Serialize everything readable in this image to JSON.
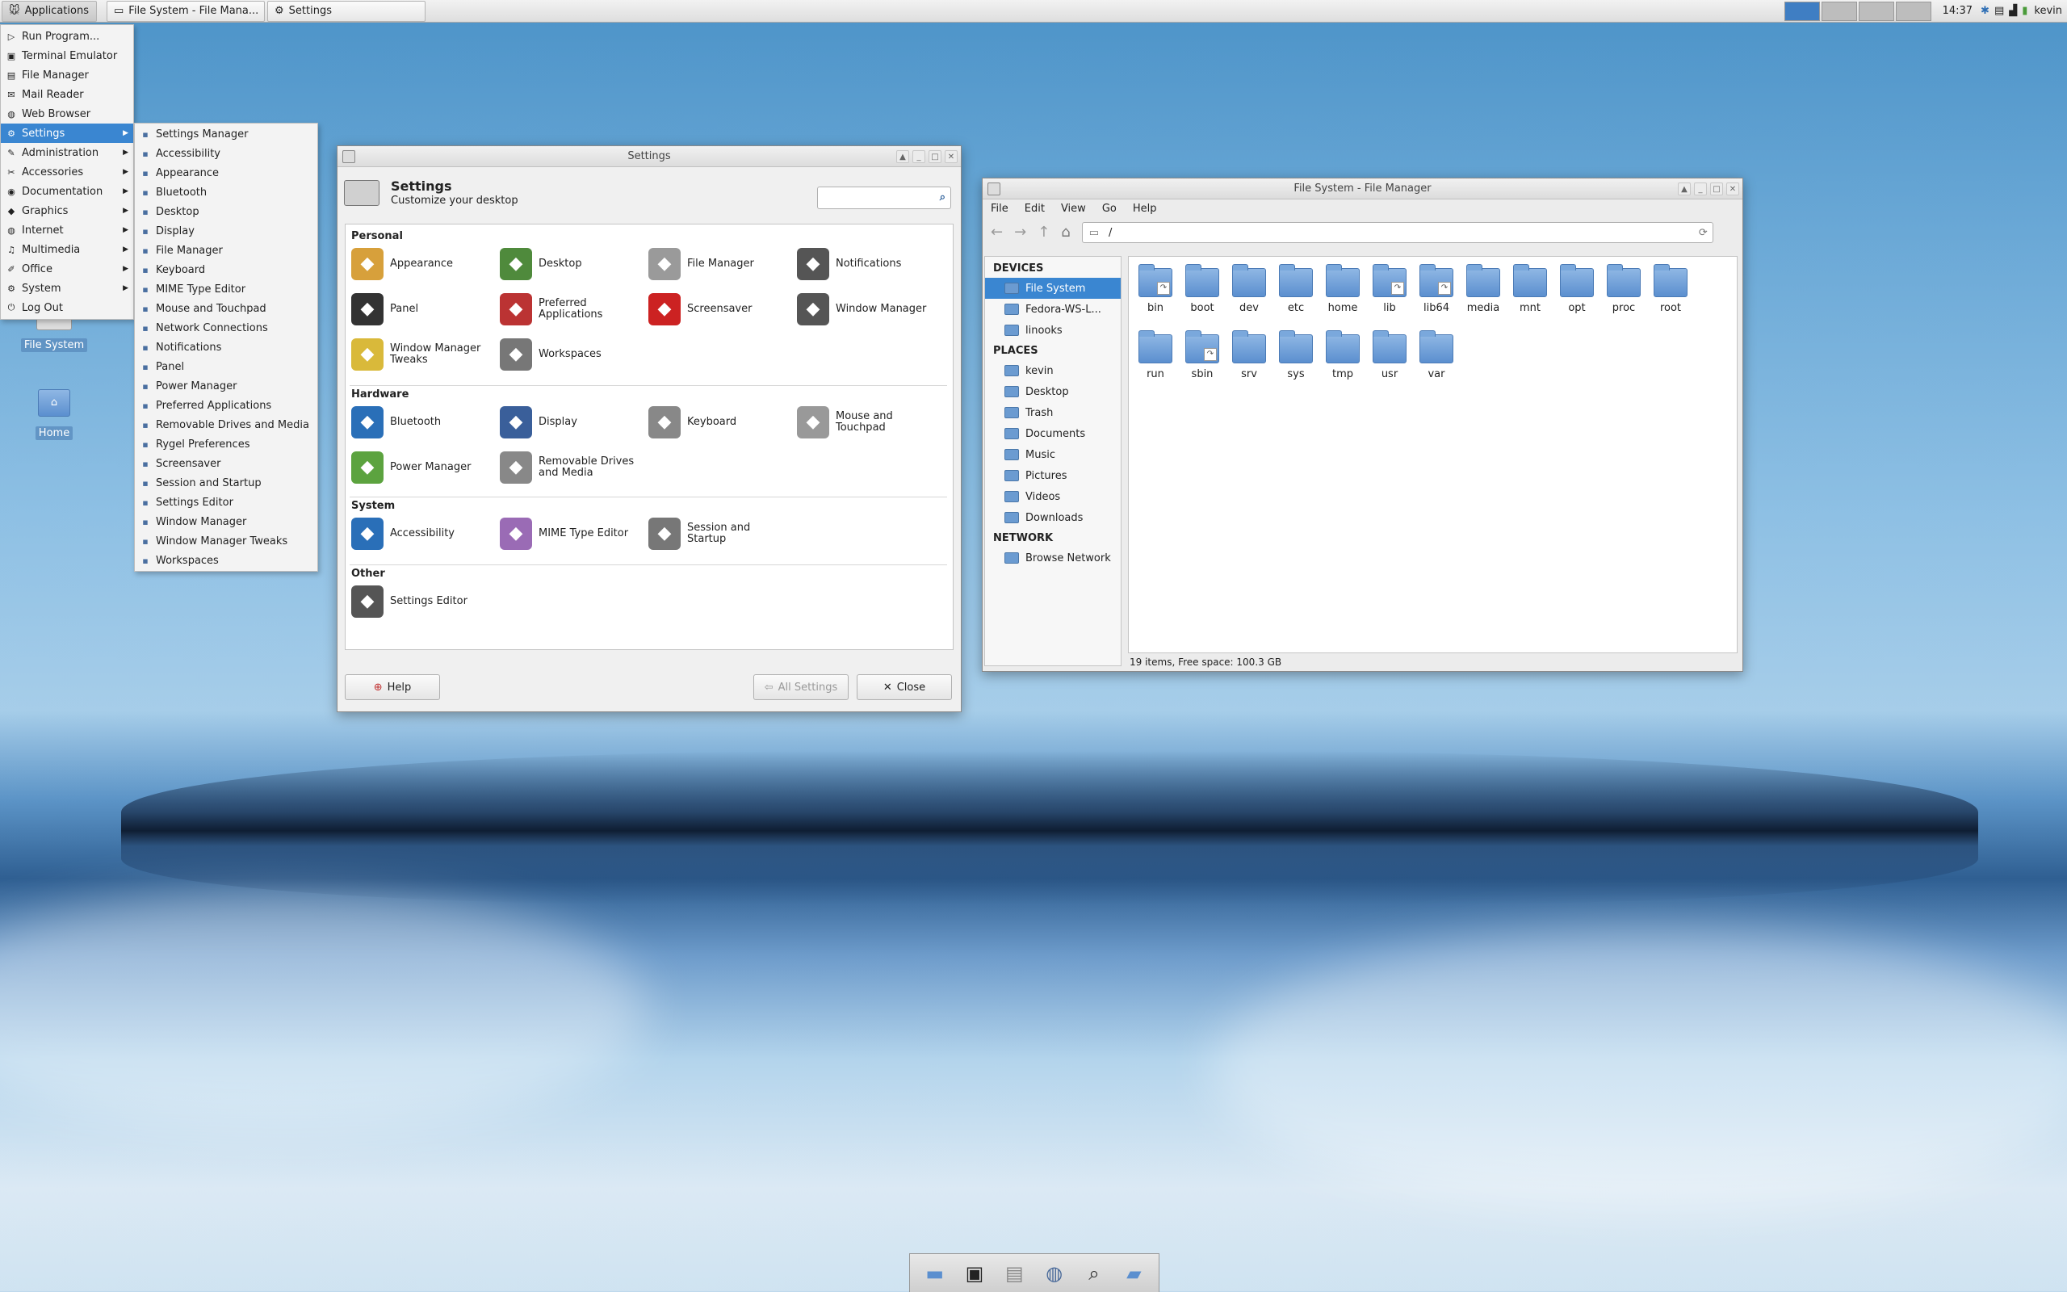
{
  "top_panel": {
    "applications_label": "Applications",
    "tasks": [
      "File System - File Mana...",
      "Settings"
    ],
    "clock": "14:37",
    "user": "kevin"
  },
  "app_menu": {
    "items": [
      {
        "label": "Run Program...",
        "icon": "run-icon"
      },
      {
        "label": "Terminal Emulator",
        "icon": "terminal-icon"
      },
      {
        "label": "File Manager",
        "icon": "file-manager-icon"
      },
      {
        "label": "Mail Reader",
        "icon": "mail-icon"
      },
      {
        "label": "Web Browser",
        "icon": "web-browser-icon"
      },
      {
        "label": "Settings",
        "icon": "settings-icon",
        "submenu": true,
        "selected": true
      },
      {
        "label": "Administration",
        "icon": "administration-icon",
        "submenu": true
      },
      {
        "label": "Accessories",
        "icon": "accessories-icon",
        "submenu": true
      },
      {
        "label": "Documentation",
        "icon": "documentation-icon",
        "submenu": true
      },
      {
        "label": "Graphics",
        "icon": "graphics-icon",
        "submenu": true
      },
      {
        "label": "Internet",
        "icon": "internet-icon",
        "submenu": true
      },
      {
        "label": "Multimedia",
        "icon": "multimedia-icon",
        "submenu": true
      },
      {
        "label": "Office",
        "icon": "office-icon",
        "submenu": true
      },
      {
        "label": "System",
        "icon": "system-icon",
        "submenu": true
      },
      {
        "label": "Log Out",
        "icon": "log-out-icon"
      }
    ]
  },
  "settings_submenu": {
    "items": [
      "Settings Manager",
      "Accessibility",
      "Appearance",
      "Bluetooth",
      "Desktop",
      "Display",
      "File Manager",
      "Keyboard",
      "MIME Type Editor",
      "Mouse and Touchpad",
      "Network Connections",
      "Notifications",
      "Panel",
      "Power Manager",
      "Preferred Applications",
      "Removable Drives and Media",
      "Rygel Preferences",
      "Screensaver",
      "Session and Startup",
      "Settings Editor",
      "Window Manager",
      "Window Manager Tweaks",
      "Workspaces"
    ]
  },
  "desktop_icons": [
    "File System",
    "Home"
  ],
  "settings_window": {
    "title": "Settings",
    "header_title": "Settings",
    "header_subtitle": "Customize your desktop",
    "sections": {
      "personal": "Personal",
      "hardware": "Hardware",
      "system": "System",
      "other": "Other"
    },
    "personal_items": [
      {
        "l1": "Appearance",
        "l2": ""
      },
      {
        "l1": "Desktop",
        "l2": ""
      },
      {
        "l1": "File Manager",
        "l2": ""
      },
      {
        "l1": "Notifications",
        "l2": ""
      },
      {
        "l1": "Panel",
        "l2": ""
      },
      {
        "l1": "Preferred",
        "l2": "Applications"
      },
      {
        "l1": "Screensaver",
        "l2": ""
      },
      {
        "l1": "Window Manager",
        "l2": ""
      },
      {
        "l1": "Window Manager",
        "l2": "Tweaks"
      },
      {
        "l1": "Workspaces",
        "l2": ""
      }
    ],
    "hardware_items": [
      {
        "l1": "Bluetooth",
        "l2": ""
      },
      {
        "l1": "Display",
        "l2": ""
      },
      {
        "l1": "Keyboard",
        "l2": ""
      },
      {
        "l1": "Mouse and",
        "l2": "Touchpad"
      },
      {
        "l1": "Power Manager",
        "l2": ""
      },
      {
        "l1": "Removable Drives",
        "l2": "and Media"
      }
    ],
    "system_items": [
      {
        "l1": "Accessibility",
        "l2": ""
      },
      {
        "l1": "MIME Type Editor",
        "l2": ""
      },
      {
        "l1": "Session and",
        "l2": "Startup"
      }
    ],
    "other_items": [
      {
        "l1": "Settings Editor",
        "l2": ""
      }
    ],
    "help_label": "Help",
    "all_settings_label": "All Settings",
    "close_label": "Close"
  },
  "file_manager": {
    "title": "File System - File Manager",
    "menu": [
      "File",
      "Edit",
      "View",
      "Go",
      "Help"
    ],
    "path": "/",
    "sidebar": {
      "devices_heading": "DEVICES",
      "devices": [
        "File System",
        "Fedora-WS-L...",
        "linooks"
      ],
      "places_heading": "PLACES",
      "places": [
        "kevin",
        "Desktop",
        "Trash",
        "Documents",
        "Music",
        "Pictures",
        "Videos",
        "Downloads"
      ],
      "network_heading": "NETWORK",
      "network": [
        "Browse Network"
      ]
    },
    "folders": [
      "bin",
      "boot",
      "dev",
      "etc",
      "home",
      "lib",
      "lib64",
      "media",
      "mnt",
      "opt",
      "proc",
      "root",
      "run",
      "sbin",
      "srv",
      "sys",
      "tmp",
      "usr",
      "var"
    ],
    "status": "19 items, Free space: 100.3 GB"
  },
  "colors": {
    "selection": "#3a86d1",
    "accent": "#3f7ec3"
  }
}
